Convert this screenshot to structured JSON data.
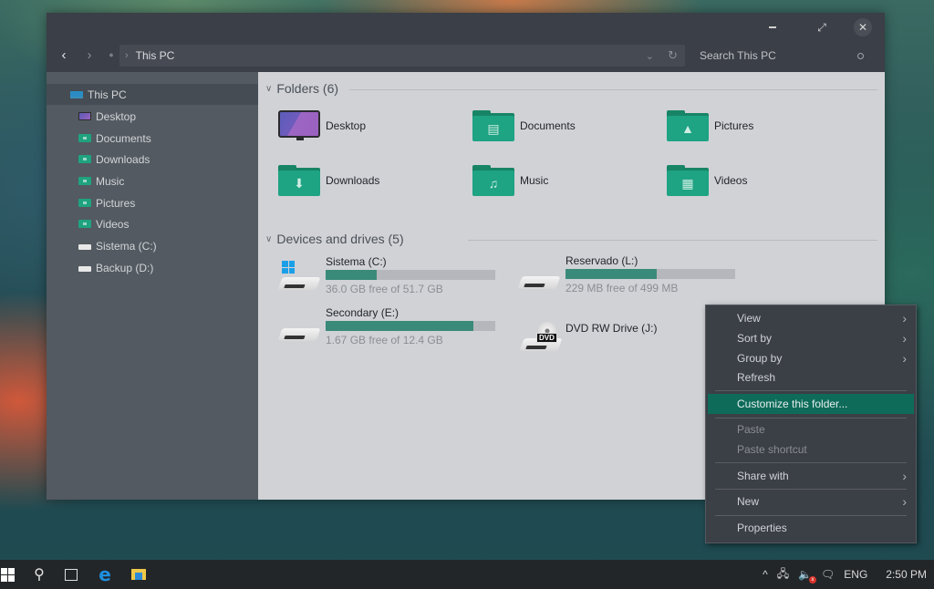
{
  "window": {
    "controls": {
      "minimize": "–",
      "maximize": "⤢",
      "close": "✕"
    }
  },
  "navbar": {
    "back": "‹",
    "forward": "›",
    "up": "●",
    "breadcrumb_sep": "›",
    "address": "This PC",
    "dropdown": "⌄",
    "refresh": "↻",
    "search_placeholder": "Search This PC"
  },
  "sidebar": {
    "items": [
      {
        "label": "This PC",
        "icon": "computer-icon",
        "selected": true
      },
      {
        "label": "Desktop",
        "icon": "desktop-icon"
      },
      {
        "label": "Documents",
        "icon": "documents-folder-icon"
      },
      {
        "label": "Downloads",
        "icon": "downloads-folder-icon"
      },
      {
        "label": "Music",
        "icon": "music-folder-icon"
      },
      {
        "label": "Pictures",
        "icon": "pictures-folder-icon"
      },
      {
        "label": "Videos",
        "icon": "videos-folder-icon"
      },
      {
        "label": "Sistema (C:)",
        "icon": "system-drive-icon"
      },
      {
        "label": "Backup (D:)",
        "icon": "drive-icon"
      }
    ]
  },
  "folders": {
    "header": "Folders (6)",
    "items": [
      {
        "label": "Desktop",
        "glyph": ""
      },
      {
        "label": "Documents",
        "glyph": "▤"
      },
      {
        "label": "Pictures",
        "glyph": "▲"
      },
      {
        "label": "Downloads",
        "glyph": "⬇"
      },
      {
        "label": "Music",
        "glyph": "♫"
      },
      {
        "label": "Videos",
        "glyph": "▦"
      }
    ]
  },
  "drives": {
    "header": "Devices and drives (5)",
    "items": [
      {
        "name": "Sistema (C:)",
        "free": "36.0 GB free of 51.7 GB",
        "used_fraction": 0.3,
        "type": "system"
      },
      {
        "name": "Reservado (L:)",
        "free": "229 MB free of 499 MB",
        "used_fraction": 0.54,
        "type": "hdd"
      },
      {
        "name": "Secondary (E:)",
        "free": "1.67 GB free of 12.4 GB",
        "used_fraction": 0.87,
        "type": "hdd"
      },
      {
        "name": "DVD RW Drive (J:)",
        "type": "dvd",
        "dvd_label": "DVD"
      }
    ]
  },
  "context_menu": {
    "items": [
      {
        "label": "View",
        "submenu": true
      },
      {
        "label": "Sort by",
        "submenu": true
      },
      {
        "label": "Group by",
        "submenu": true
      },
      {
        "label": "Refresh"
      },
      {
        "label": "Customize this folder...",
        "highlighted": true
      },
      {
        "label": "Paste",
        "disabled": true
      },
      {
        "label": "Paste shortcut",
        "disabled": true
      },
      {
        "label": "Share with",
        "submenu": true
      },
      {
        "label": "New",
        "submenu": true
      },
      {
        "label": "Properties"
      }
    ],
    "arrow": "›"
  },
  "taskbar": {
    "search_glyph": "⚲",
    "edge_glyph": "e",
    "tray": {
      "chevron": "^",
      "network": "🖧",
      "volume": "🔈",
      "volume_muted": "x",
      "notifications": "🗨",
      "language": "ENG",
      "time": "2:50 PM"
    }
  },
  "colors": {
    "accent": "#0e6b5a",
    "folder": "#1ea383",
    "drive_bar_fill": "#3a8a7a"
  }
}
